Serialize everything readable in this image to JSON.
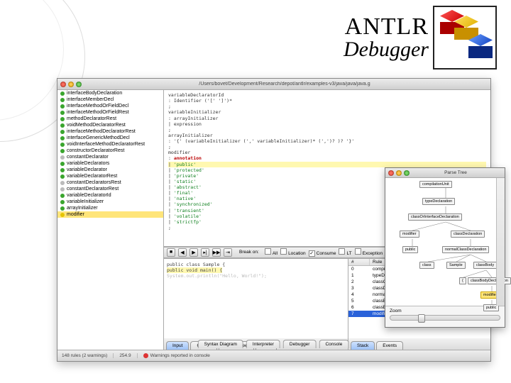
{
  "title": {
    "line1": "ANTLR",
    "line2": "Debugger"
  },
  "window": {
    "path": "/Users/bovet/Development/Research/depot/antlr/examples-v3/java/java/java.g"
  },
  "rules": [
    {
      "label": "interfaceBodyDeclaration",
      "color": "green"
    },
    {
      "label": "interfaceMemberDecl",
      "color": "green"
    },
    {
      "label": "interfaceMethodOrFieldDecl",
      "color": "green"
    },
    {
      "label": "interfaceMethodOrFieldRest",
      "color": "green"
    },
    {
      "label": "methodDeclaratorRest",
      "color": "green"
    },
    {
      "label": "voidMethodDeclaratorRest",
      "color": "green"
    },
    {
      "label": "interfaceMethodDeclaratorRest",
      "color": "green"
    },
    {
      "label": "interfaceGenericMethodDecl",
      "color": "green"
    },
    {
      "label": "voidInterfaceMethodDeclaratorRest",
      "color": "green"
    },
    {
      "label": "constructorDeclaratorRest",
      "color": "green"
    },
    {
      "label": "constantDeclarator",
      "color": "gray"
    },
    {
      "label": "variableDeclarators",
      "color": "green"
    },
    {
      "label": "variableDeclarator",
      "color": "green"
    },
    {
      "label": "variableDeclaratorRest",
      "color": "green"
    },
    {
      "label": "constantDeclaratorsRest",
      "color": "gray"
    },
    {
      "label": "constantDeclaratorRest",
      "color": "gray"
    },
    {
      "label": "variableDeclaratorId",
      "color": "green"
    },
    {
      "label": "variableInitializer",
      "color": "green"
    },
    {
      "label": "arrayInitializer",
      "color": "green"
    },
    {
      "label": "modifier",
      "color": "y",
      "selected": true
    }
  ],
  "editor": {
    "lines": [
      "variableDeclaratorId",
      "    :   Identifier ('[' ']')*",
      "    ;",
      "",
      "variableInitializer",
      "    :   arrayInitializer",
      "    |   expression",
      "    ;",
      "",
      "arrayInitializer",
      "    :   '{' (variableInitializer (',' variableInitializer)* (',')? )? '}'",
      "    ;",
      "",
      "modifier"
    ],
    "modifier_alts": [
      "annotation",
      "'public'",
      "'protected'",
      "'private'",
      "'static'",
      "'abstract'",
      "'final'",
      "'native'",
      "'synchronized'",
      "'transient'",
      "'volatile'",
      "'strictfp'"
    ],
    "highlight_alt_index": 1
  },
  "debugbar": {
    "break_on_label": "Break on:",
    "opts": [
      {
        "label": "All",
        "checked": false
      },
      {
        "label": "Location",
        "checked": false
      },
      {
        "label": "Consume",
        "checked": true
      },
      {
        "label": "LT",
        "checked": false
      },
      {
        "label": "Exception",
        "checked": false
      }
    ]
  },
  "sample": {
    "line1": "public class Sample {",
    "line2": "  public void main() {",
    "line3": "    System.out.println(\"Hello, World!\");"
  },
  "stack": {
    "col1": "#",
    "col2": "Rule",
    "rows": [
      {
        "n": "0",
        "rule": "compilationUnit"
      },
      {
        "n": "1",
        "rule": "typeDeclaration"
      },
      {
        "n": "2",
        "rule": "classOrInterfaceDeclaration"
      },
      {
        "n": "3",
        "rule": "classDeclaration"
      },
      {
        "n": "4",
        "rule": "normalClassDeclaration"
      },
      {
        "n": "5",
        "rule": "classBody"
      },
      {
        "n": "6",
        "rule": "classBodyDeclaration"
      },
      {
        "n": "7",
        "rule": "modifier",
        "selected": true
      }
    ]
  },
  "tabs_left": [
    {
      "label": "Input",
      "blue": true
    },
    {
      "label": "Output",
      "blue": false
    },
    {
      "label": "Parse Tree",
      "blue": false
    },
    {
      "label": "AST",
      "blue": false
    }
  ],
  "tabs_right": [
    {
      "label": "Stack",
      "blue": true
    },
    {
      "label": "Events",
      "blue": false
    }
  ],
  "global_tabs": [
    "Syntax Diagram",
    "Interpreter",
    "Debugger",
    "Console"
  ],
  "status": {
    "rules": "148 rules (2 warnings)",
    "mem": "254.9",
    "msg": "Warnings reported in console"
  },
  "parse_tree": {
    "title": "Parse Tree",
    "zoom_label": "Zoom",
    "nodes": {
      "n0": "compilationUnit",
      "n1": "typeDeclaration",
      "n2": "classOrInterfaceDeclaration",
      "n3": "modifier",
      "n4": "classDeclaration",
      "n5": "public",
      "n6": "normalClassDeclaration",
      "n7": "class",
      "n8": "Sample",
      "n9": "classBody",
      "n10": "{",
      "n11": "classBodyDeclaration",
      "n12": "modifier",
      "n13": "public"
    }
  }
}
